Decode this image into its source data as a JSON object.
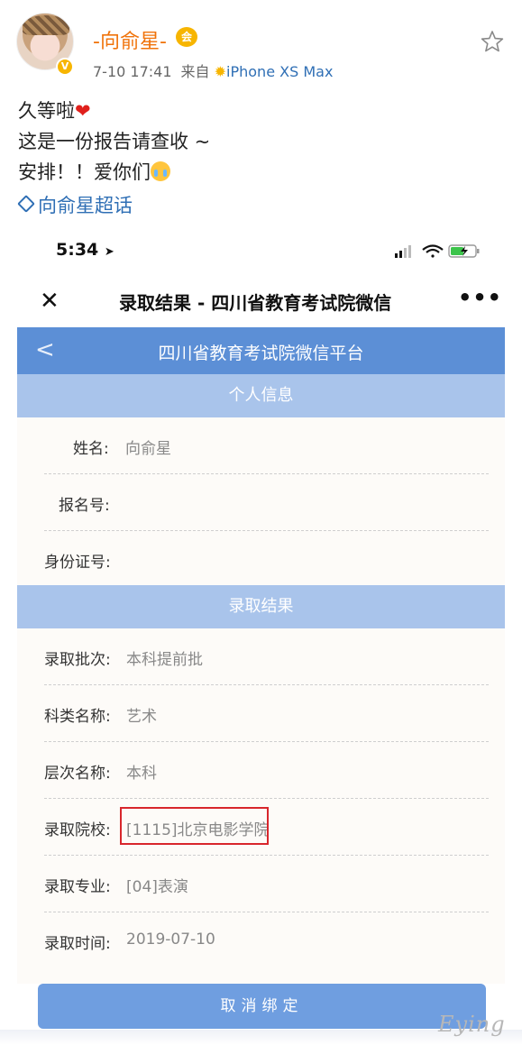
{
  "post": {
    "user_name": "-向俞星-",
    "member_badge": "会",
    "verified_mark": "V",
    "time": "7-10 17:41",
    "source_prefix": "来自",
    "device": "iPhone XS Max",
    "text_line1": "久等啦",
    "text_line2": "这是一份报告请查收 ~",
    "text_line3": "安排！！爱你们",
    "topic": "向俞星超话"
  },
  "screenshot": {
    "status_time": "5:34",
    "page_title": "录取结果 - 四川省教育考试院微信",
    "platform_title": "四川省教育考试院微信平台",
    "section_personal": "个人信息",
    "section_result": "录取结果",
    "fields": [
      {
        "label": "姓名:",
        "value": "向俞星"
      },
      {
        "label": "报名号:",
        "value": ""
      },
      {
        "label": "身份证号:",
        "value": ""
      },
      {
        "label": "录取批次:",
        "value": "本科提前批"
      },
      {
        "label": "科类名称:",
        "value": "艺术"
      },
      {
        "label": "层次名称:",
        "value": "本科"
      },
      {
        "label": "录取院校:",
        "value": "[1115]北京电影学院"
      },
      {
        "label": "录取专业:",
        "value": "[04]表演"
      },
      {
        "label": "录取时间:",
        "value": "2019-07-10"
      }
    ],
    "unbind_label": "取消绑定",
    "watermark": "Eying"
  },
  "colors": {
    "username": "#f0730a",
    "link": "#2f6fb5",
    "header_blue": "#5c8fd6",
    "section_blue": "#a9c4eb",
    "button_blue": "#6f9ee0",
    "highlight_red": "#d8262c"
  },
  "icons": [
    "star-icon",
    "verified-icon",
    "diamond-icon",
    "close-icon",
    "more-icon",
    "back-icon",
    "signal-icon",
    "wifi-icon",
    "battery-icon"
  ]
}
